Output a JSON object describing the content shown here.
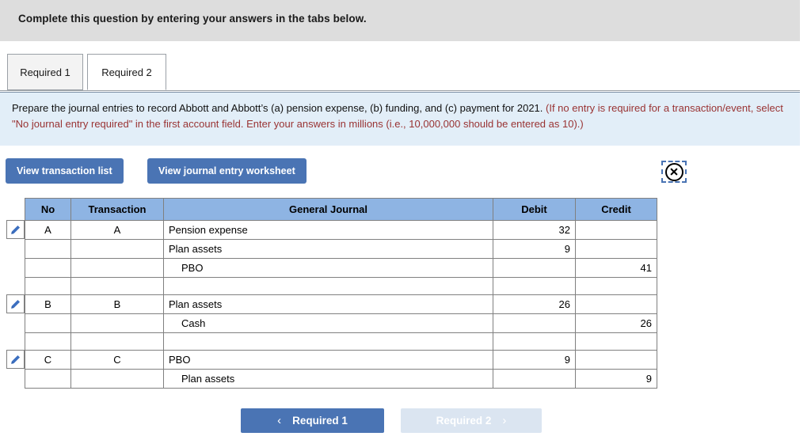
{
  "header": {
    "banner_text": "Complete this question by entering your answers in the tabs below."
  },
  "tabs": [
    {
      "label": "Required 1",
      "active": false
    },
    {
      "label": "Required 2",
      "active": true
    }
  ],
  "instruction": {
    "black_text": "Prepare the journal entries to record Abbott and Abbott’s (a) pension expense, (b) funding, and (c) payment for 2021. ",
    "red_text": "(If no entry is required for a transaction/event, select \"No journal entry required\" in the first account field. Enter your answers in millions (i.e., 10,000,000 should be entered as 10).)"
  },
  "toolbar": {
    "view_transaction_list": "View transaction list",
    "view_journal_worksheet": "View journal entry worksheet",
    "close_icon": "close-circle-icon"
  },
  "table": {
    "columns": [
      "No",
      "Transaction",
      "General Journal",
      "Debit",
      "Credit"
    ],
    "rows": [
      {
        "edit": true,
        "no": "A",
        "transaction": "A",
        "account": "Pension expense",
        "indent": false,
        "debit": "32",
        "credit": ""
      },
      {
        "edit": false,
        "no": "",
        "transaction": "",
        "account": "Plan assets",
        "indent": false,
        "debit": "9",
        "credit": ""
      },
      {
        "edit": false,
        "no": "",
        "transaction": "",
        "account": "PBO",
        "indent": true,
        "debit": "",
        "credit": "41"
      },
      {
        "edit": false,
        "no": "",
        "transaction": "",
        "account": "",
        "indent": false,
        "debit": "",
        "credit": "",
        "spacer": true
      },
      {
        "edit": true,
        "no": "B",
        "transaction": "B",
        "account": "Plan assets",
        "indent": false,
        "debit": "26",
        "credit": ""
      },
      {
        "edit": false,
        "no": "",
        "transaction": "",
        "account": "Cash",
        "indent": true,
        "debit": "",
        "credit": "26"
      },
      {
        "edit": false,
        "no": "",
        "transaction": "",
        "account": "",
        "indent": false,
        "debit": "",
        "credit": "",
        "spacer": true
      },
      {
        "edit": true,
        "no": "C",
        "transaction": "C",
        "account": "PBO",
        "indent": false,
        "debit": "9",
        "credit": ""
      },
      {
        "edit": false,
        "no": "",
        "transaction": "",
        "account": "Plan assets",
        "indent": true,
        "debit": "",
        "credit": "9"
      }
    ]
  },
  "navigation": {
    "prev_label": "Required 1",
    "prev_chevron": "‹",
    "next_label": "Required 2",
    "next_chevron": "›"
  },
  "colors": {
    "accent_blue": "#4a74b4",
    "table_header_blue": "#8eb4e3",
    "instruction_bg": "#e2eef8",
    "banner_bg": "#dddddd",
    "red_text": "#993333",
    "disabled_blue": "#dbe5f1"
  }
}
